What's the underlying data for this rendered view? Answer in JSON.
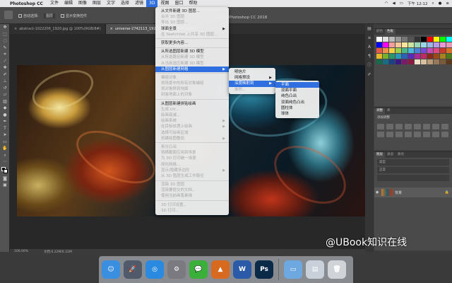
{
  "menubar": {
    "app_name": "Photoshop CC",
    "items": [
      "文件",
      "编辑",
      "图像",
      "图层",
      "文字",
      "选择",
      "滤镜",
      "3D",
      "视图",
      "窗口",
      "帮助"
    ],
    "active_item": "3D",
    "clock": "下午 12:12",
    "status_icons": [
      "wifi-icon",
      "volume-icon",
      "battery-icon",
      "search-icon",
      "user-icon",
      "list-icon"
    ]
  },
  "options_bar": {
    "auto_select_label": "自动选择:",
    "auto_select_value": "图层",
    "show_transform_label": "显示变换控件",
    "window_title": "Adobe Photoshop CC 2018"
  },
  "tabs": [
    {
      "label": "abstract-1022206_1920.jpg @ 100%(RGB/8#)",
      "active": false
    },
    {
      "label": "universe-2742113_1920.jpg @ 100%(RGB/8#)",
      "active": true
    }
  ],
  "toolbar_icons": [
    "move-icon",
    "marquee-icon",
    "lasso-icon",
    "quick-select-icon",
    "crop-icon",
    "eyedropper-icon",
    "healing-icon",
    "brush-icon",
    "stamp-icon",
    "history-brush-icon",
    "eraser-icon",
    "gradient-icon",
    "blur-icon",
    "dodge-icon",
    "pen-icon",
    "type-icon",
    "path-select-icon",
    "shape-icon",
    "hand-icon",
    "zoom-icon",
    "more-icon",
    "color-swatch-icon",
    "quick-mask-icon",
    "screen-mode-icon"
  ],
  "status": {
    "zoom": "100.00%",
    "doc_info": "文档:6.22M/6.22M"
  },
  "panels": {
    "color_tabs": [
      "颜色",
      "色板"
    ],
    "adjust_tabs": [
      "调整",
      "库"
    ],
    "adjust_label": "添加调整",
    "layers_tabs": [
      "图层",
      "通道",
      "路径"
    ],
    "layer_kind": "类型",
    "layer_mode": "正常",
    "layer_name": "背景"
  },
  "menu_3d": {
    "items": [
      {
        "label": "从文件新建 3D 图层...",
        "enabled": true
      },
      {
        "label": "合并 3D 图层",
        "enabled": false
      },
      {
        "label": "导出 3D 图层...",
        "enabled": false
      },
      {
        "label": "球面全景",
        "enabled": true,
        "submenu": true
      },
      {
        "label": "在 Sketchfab 上共享 3D 图层...",
        "enabled": false
      },
      {
        "sep": true
      },
      {
        "label": "获取更多内容...",
        "enabled": true
      },
      {
        "sep": true
      },
      {
        "label": "从所选图层新建 3D 模型",
        "enabled": true
      },
      {
        "label": "从所选路径新建 3D 模型",
        "enabled": false
      },
      {
        "label": "从当前选区新建 3D 模型",
        "enabled": false
      },
      {
        "label": "从图层新建网格",
        "enabled": true,
        "submenu": true,
        "selected": true
      },
      {
        "sep": true
      },
      {
        "label": "编组对象",
        "enabled": false
      },
      {
        "label": "将场景中的所有对象编组",
        "enabled": false
      },
      {
        "label": "将对象移到地面",
        "enabled": false
      },
      {
        "label": "封装地面上的对象",
        "enabled": false
      },
      {
        "sep": true
      },
      {
        "label": "从图层新建拼贴绘画",
        "enabled": true
      },
      {
        "label": "生成 UV...",
        "enabled": false
      },
      {
        "label": "绘画衰减...",
        "enabled": false
      },
      {
        "label": "绘画系统",
        "enabled": false,
        "submenu": true
      },
      {
        "label": "在目标纹理上绘画",
        "enabled": false,
        "submenu": true
      },
      {
        "label": "选择可绘画区域",
        "enabled": false
      },
      {
        "label": "创建绘图叠加",
        "enabled": false,
        "submenu": true
      },
      {
        "sep": true
      },
      {
        "label": "拆分凸出",
        "enabled": false
      },
      {
        "label": "将横截面应用到场景",
        "enabled": false
      },
      {
        "label": "为 3D 打印统一场景",
        "enabled": false
      },
      {
        "label": "简化网格...",
        "enabled": false
      },
      {
        "label": "显示/隐藏多边形",
        "enabled": false,
        "submenu": true
      },
      {
        "label": "从 3D 图层生成工作路径",
        "enabled": false
      },
      {
        "sep": true
      },
      {
        "label": "渲染 3D 图层",
        "enabled": false
      },
      {
        "label": "渲染要提交的文档...",
        "enabled": false
      },
      {
        "label": "使用当前画笔素描",
        "enabled": false
      },
      {
        "sep": true
      },
      {
        "label": "3D 打印设置...",
        "enabled": false
      },
      {
        "label": "3D 打印...",
        "enabled": false
      }
    ]
  },
  "submenu_mesh": {
    "items": [
      {
        "label": "明信片",
        "enabled": true
      },
      {
        "label": "网格预设",
        "enabled": true,
        "submenu": true
      },
      {
        "label": "深度映射到",
        "enabled": true,
        "submenu": true,
        "selected": true
      },
      {
        "label": "体积...",
        "enabled": false
      }
    ]
  },
  "submenu_depth": {
    "items": [
      {
        "label": "平面",
        "selected": true
      },
      {
        "label": "双面平面"
      },
      {
        "label": "纯色凸出"
      },
      {
        "label": "双面纯色凸出"
      },
      {
        "label": "圆柱体"
      },
      {
        "label": "球体"
      }
    ]
  },
  "watermark": "@UBook知识在线",
  "dock": [
    {
      "name": "finder-icon",
      "color": "#3b8fe0",
      "glyph": "☺"
    },
    {
      "name": "launchpad-icon",
      "color": "#505a6a",
      "glyph": "🚀"
    },
    {
      "name": "safari-icon",
      "color": "#2a8ae0",
      "glyph": "◎"
    },
    {
      "name": "system-preferences-icon",
      "color": "#7a7a80",
      "glyph": "⚙"
    },
    {
      "name": "wechat-icon",
      "color": "#3ab03a",
      "glyph": "💬"
    },
    {
      "name": "matlab-icon",
      "color": "#d86a20",
      "glyph": "▲"
    },
    {
      "name": "word-icon",
      "color": "#2a5aa8",
      "glyph": "W"
    },
    {
      "name": "photoshop-icon",
      "color": "#0a2a48",
      "glyph": "Ps"
    },
    {
      "name": "folder-icon",
      "color": "#6ea8e0",
      "glyph": "▭"
    },
    {
      "name": "window-preview-icon",
      "color": "#c8d0da",
      "glyph": "▤"
    },
    {
      "name": "trash-icon",
      "color": "#d0d4d8",
      "glyph": "🗑"
    }
  ]
}
